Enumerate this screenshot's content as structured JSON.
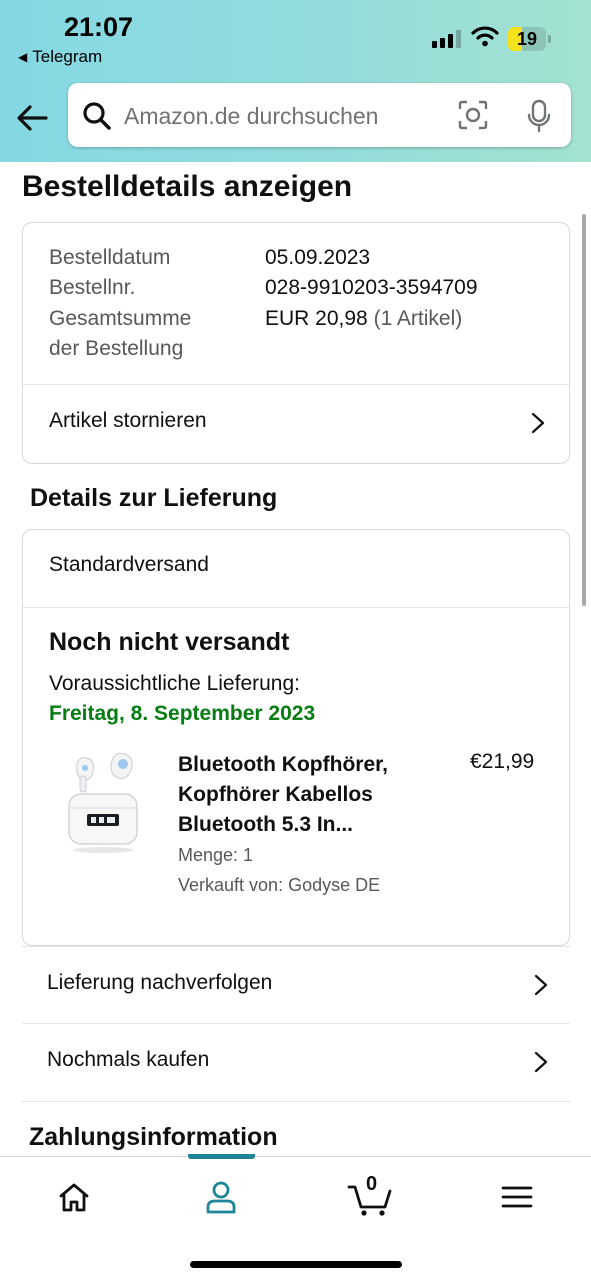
{
  "status_bar": {
    "time": "21:07",
    "back_app": "Telegram",
    "battery": "19"
  },
  "search": {
    "placeholder": "Amazon.de durchsuchen"
  },
  "page_title": "Bestelldetails anzeigen",
  "order_summary": {
    "date_label": "Bestelldatum",
    "date_value": "05.09.2023",
    "number_label": "Bestellnr.",
    "number_value": "028-9910203-3594709",
    "total_label_1": "Gesamtsumme",
    "total_label_2": "der Bestellung",
    "total_value": "EUR 20,98",
    "total_items": "(1 Artikel)",
    "cancel_label": "Artikel stornieren"
  },
  "delivery": {
    "section_title": "Details zur Lieferung",
    "shipping_method": "Standardversand",
    "status": "Noch nicht versandt",
    "estimated_label": "Voraussichtliche Lieferung:",
    "estimated_date": "Freitag, 8. September 2023",
    "item": {
      "title_line1": "Bluetooth Kopfhörer,",
      "title_line2": "Kopfhörer Kabellos",
      "title_line3": "Bluetooth 5.3 In...",
      "price": "€21,99",
      "quantity": "Menge: 1",
      "seller": "Verkauft von: Godyse DE"
    }
  },
  "actions": {
    "track": "Lieferung nachverfolgen",
    "buy_again": "Nochmals kaufen"
  },
  "payment": {
    "section_title": "Zahlungsinformation"
  },
  "tabbar": {
    "cart_count": "0",
    "accent_color": "#1d8597"
  },
  "colors": {
    "delivery_date": "#067d13"
  }
}
